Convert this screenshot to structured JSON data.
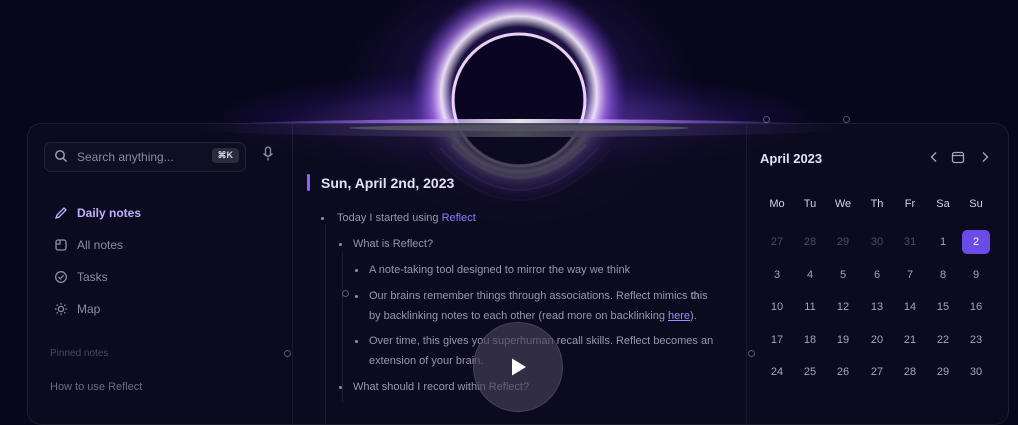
{
  "search": {
    "placeholder": "Search anything...",
    "shortcut": "⌘K"
  },
  "nav": [
    {
      "label": "Daily notes",
      "icon": "pencil-icon",
      "active": true
    },
    {
      "label": "All notes",
      "icon": "notes-icon"
    },
    {
      "label": "Tasks",
      "icon": "check-circle-icon"
    },
    {
      "label": "Map",
      "icon": "sun-icon"
    }
  ],
  "sidebar": {
    "pinned_label": "Pinned notes",
    "pinned_items": [
      "How to use Reflect"
    ]
  },
  "note": {
    "date": "Sun, April 2nd, 2023",
    "line1_prefix": "Today I started using ",
    "line1_link": "Reflect",
    "line2": "What is Reflect?",
    "line3": "A note-taking tool designed to mirror the way we think",
    "line4": "Our brains remember things through associations. Reflect mimics this",
    "line5_prefix": "by backlinking notes to each other (read more on backlinking ",
    "line5_link": "here",
    "line5_suffix": ").",
    "line6": "Over time, this gives you superhuman recall skills. Reflect becomes an",
    "line7": "extension of your brain.",
    "line8": "What should I record within Reflect?"
  },
  "calendar": {
    "title": "April 2023",
    "weekdays": [
      "Mo",
      "Tu",
      "We",
      "Th",
      "Fr",
      "Sa",
      "Su"
    ],
    "weeks": [
      [
        "27",
        "28",
        "29",
        "30",
        "31",
        "1",
        "2"
      ],
      [
        "3",
        "4",
        "5",
        "6",
        "7",
        "8",
        "9"
      ],
      [
        "10",
        "11",
        "12",
        "13",
        "14",
        "15",
        "16"
      ],
      [
        "17",
        "18",
        "19",
        "20",
        "21",
        "22",
        "23"
      ],
      [
        "24",
        "25",
        "26",
        "27",
        "28",
        "29",
        "30"
      ]
    ],
    "dim_count_first_week": 5,
    "selected": "2"
  },
  "colors": {
    "accent": "#8b63ff",
    "selected_day": "#6a4be8",
    "background": "#07061a"
  }
}
